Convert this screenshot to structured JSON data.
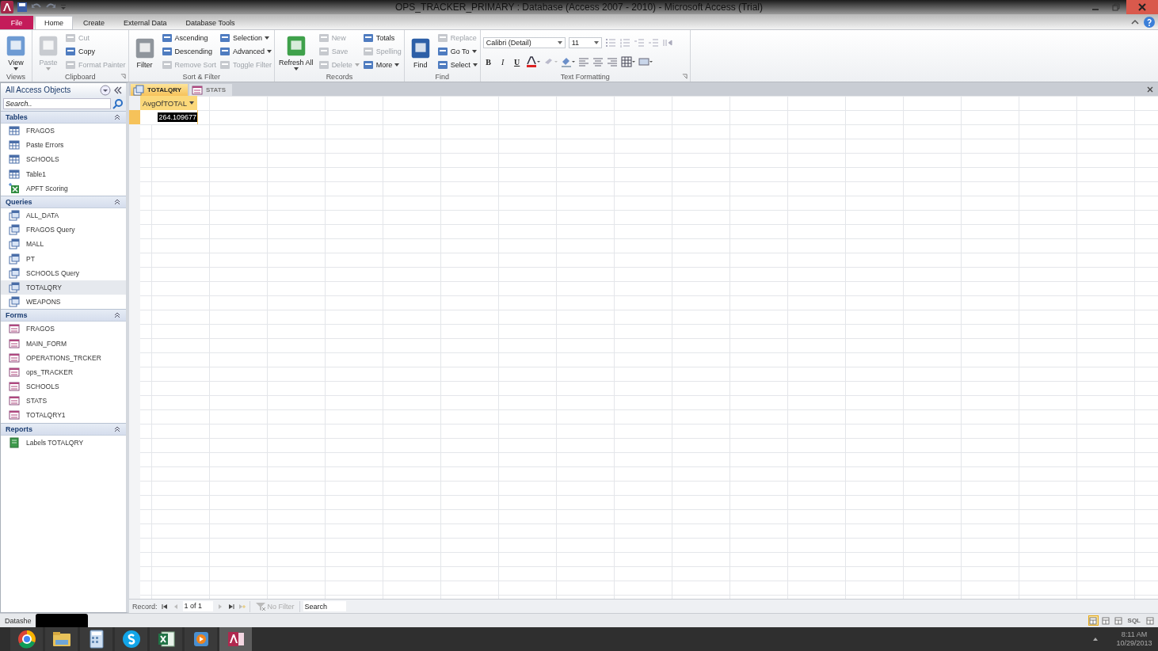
{
  "window": {
    "title": "OPS_TRACKER_PRIMARY : Database (Access 2007 - 2010)  -  Microsoft Access (Trial)"
  },
  "ribbon_tabs": [
    {
      "label": "File",
      "kind": "file",
      "selected": false
    },
    {
      "label": "Home",
      "kind": "tab",
      "selected": true
    },
    {
      "label": "Create",
      "kind": "tab",
      "selected": false
    },
    {
      "label": "External Data",
      "kind": "tab",
      "selected": false
    },
    {
      "label": "Database Tools",
      "kind": "tab",
      "selected": false
    }
  ],
  "ribbon_groups": [
    {
      "label": "Views",
      "launcher": false,
      "columns": [
        [
          {
            "label": "View",
            "kind": "large",
            "dropdown": true,
            "disabled": false
          }
        ]
      ]
    },
    {
      "label": "Clipboard",
      "launcher": true,
      "columns": [
        [
          {
            "label": "Paste",
            "kind": "large",
            "dropdown": true,
            "disabled": true
          }
        ],
        [
          {
            "label": "Cut",
            "kind": "small",
            "dropdown": false,
            "disabled": true
          },
          {
            "label": "Copy",
            "kind": "small",
            "dropdown": false,
            "disabled": false
          },
          {
            "label": "Format Painter",
            "kind": "small",
            "dropdown": false,
            "disabled": true
          }
        ]
      ]
    },
    {
      "label": "Sort & Filter",
      "launcher": false,
      "columns": [
        [
          {
            "label": "Filter",
            "kind": "large",
            "dropdown": false,
            "disabled": false
          }
        ],
        [
          {
            "label": "Ascending",
            "kind": "small",
            "dropdown": false,
            "disabled": false
          },
          {
            "label": "Descending",
            "kind": "small",
            "dropdown": false,
            "disabled": false
          },
          {
            "label": "Remove Sort",
            "kind": "small",
            "dropdown": false,
            "disabled": true
          }
        ],
        [
          {
            "label": "Selection",
            "kind": "small",
            "dropdown": true,
            "disabled": false
          },
          {
            "label": "Advanced",
            "kind": "small",
            "dropdown": true,
            "disabled": false
          },
          {
            "label": "Toggle Filter",
            "kind": "small",
            "dropdown": false,
            "disabled": true
          }
        ]
      ]
    },
    {
      "label": "Records",
      "launcher": false,
      "columns": [
        [
          {
            "label": "Refresh All",
            "kind": "large",
            "dropdown": true,
            "disabled": false
          }
        ],
        [
          {
            "label": "New",
            "kind": "small",
            "dropdown": false,
            "disabled": true
          },
          {
            "label": "Save",
            "kind": "small",
            "dropdown": false,
            "disabled": true
          },
          {
            "label": "Delete",
            "kind": "small",
            "dropdown": true,
            "disabled": true
          }
        ],
        [
          {
            "label": "Totals",
            "kind": "small",
            "dropdown": false,
            "disabled": false
          },
          {
            "label": "Spelling",
            "kind": "small",
            "dropdown": false,
            "disabled": true
          },
          {
            "label": "More",
            "kind": "small",
            "dropdown": true,
            "disabled": false
          }
        ]
      ]
    },
    {
      "label": "Find",
      "launcher": false,
      "columns": [
        [
          {
            "label": "Find",
            "kind": "large",
            "dropdown": false,
            "disabled": false
          }
        ],
        [
          {
            "label": "Replace",
            "kind": "small",
            "dropdown": false,
            "disabled": true
          },
          {
            "label": "Go To",
            "kind": "small",
            "dropdown": true,
            "disabled": false
          },
          {
            "label": "Select",
            "kind": "small",
            "dropdown": true,
            "disabled": false
          }
        ]
      ]
    }
  ],
  "text_formatting": {
    "label": "Text Formatting",
    "font": "Calibri (Detail)",
    "size": "11",
    "bold": "B",
    "italic": "I",
    "underline": "U"
  },
  "navigation": {
    "title": "All Access Objects",
    "search": {
      "placeholder": "Search.."
    },
    "sections": [
      {
        "title": "Tables",
        "expanded": true,
        "items": [
          {
            "name": "FRAGOS",
            "kind": "table",
            "selected": false
          },
          {
            "name": "Paste Errors",
            "kind": "table",
            "selected": false
          },
          {
            "name": "SCHOOLS",
            "kind": "table",
            "selected": false
          },
          {
            "name": "Table1",
            "kind": "table",
            "selected": false
          },
          {
            "name": "APFT Scoring",
            "kind": "linked",
            "selected": false
          }
        ]
      },
      {
        "title": "Queries",
        "expanded": true,
        "items": [
          {
            "name": "ALL_DATA",
            "kind": "query",
            "selected": false
          },
          {
            "name": "FRAGOS Query",
            "kind": "query",
            "selected": false
          },
          {
            "name": "MALL",
            "kind": "query",
            "selected": false
          },
          {
            "name": "PT",
            "kind": "query",
            "selected": false
          },
          {
            "name": "SCHOOLS Query",
            "kind": "query",
            "selected": false
          },
          {
            "name": "TOTALQRY",
            "kind": "query",
            "selected": true
          },
          {
            "name": "WEAPONS",
            "kind": "query",
            "selected": false
          }
        ]
      },
      {
        "title": "Forms",
        "expanded": true,
        "items": [
          {
            "name": "FRAGOS",
            "kind": "form",
            "selected": false
          },
          {
            "name": "MAIN_FORM",
            "kind": "form",
            "selected": false
          },
          {
            "name": "OPERATIONS_TRCKER",
            "kind": "form",
            "selected": false
          },
          {
            "name": "ops_TRACKER",
            "kind": "form",
            "selected": false
          },
          {
            "name": "SCHOOLS",
            "kind": "form",
            "selected": false
          },
          {
            "name": "STATS",
            "kind": "form",
            "selected": false
          },
          {
            "name": "TOTALQRY1",
            "kind": "form",
            "selected": false
          }
        ]
      },
      {
        "title": "Reports",
        "expanded": true,
        "items": [
          {
            "name": "Labels TOTALQRY",
            "kind": "report",
            "selected": false
          }
        ]
      }
    ]
  },
  "document_tabs": [
    {
      "label": "TOTALQRY",
      "kind": "query",
      "selected": true
    },
    {
      "label": "STATS",
      "kind": "form",
      "selected": false
    }
  ],
  "datasheet": {
    "columns": [
      "AvgOfTOTAL"
    ],
    "rows": [
      [
        "264.109677"
      ]
    ]
  },
  "record_navigator": {
    "label": "Record:",
    "position": "1 of 1",
    "filter": "No Filter",
    "search": {
      "placeholder": "Search"
    }
  },
  "status_bar": {
    "text": "Datashe",
    "sql_label": "SQL",
    "views": [
      {
        "selected": true
      },
      {
        "selected": false
      },
      {
        "selected": false
      },
      {
        "selected": false
      },
      {
        "selected": false
      }
    ]
  },
  "taskbar": {
    "apps": [
      {
        "kind": "browser",
        "selected": false
      },
      {
        "kind": "folder",
        "selected": false
      },
      {
        "kind": "calculator",
        "selected": false
      },
      {
        "kind": "chat",
        "selected": false
      },
      {
        "kind": "spreadsheet",
        "selected": false
      },
      {
        "kind": "media",
        "selected": false
      },
      {
        "kind": "database",
        "selected": true
      }
    ],
    "time": "8:11 AM",
    "date": "10/29/2013"
  }
}
